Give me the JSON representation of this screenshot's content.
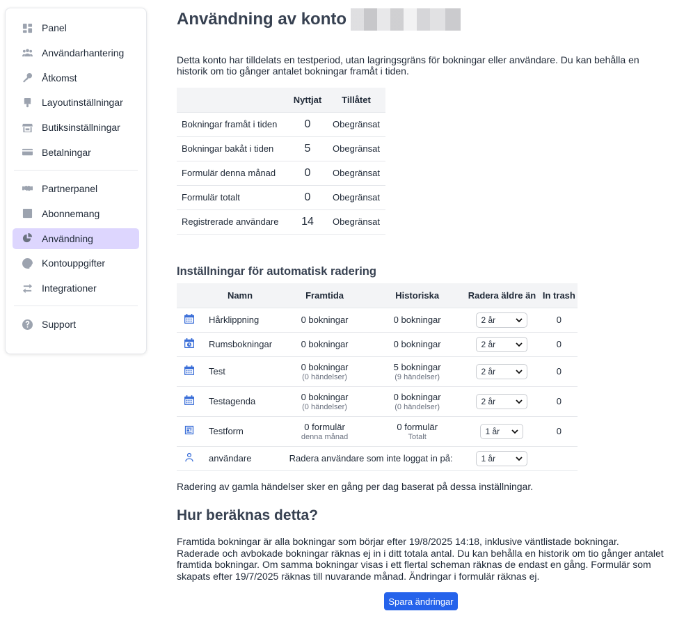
{
  "sidebar": {
    "items": [
      {
        "label": "Panel",
        "icon": "dashboard-icon"
      },
      {
        "label": "Användarhantering",
        "icon": "users-icon"
      },
      {
        "label": "Åtkomst",
        "icon": "key-icon"
      },
      {
        "label": "Layoutinställningar",
        "icon": "brush-icon"
      },
      {
        "label": "Butiksinställningar",
        "icon": "store-icon"
      },
      {
        "label": "Betalningar",
        "icon": "credit-card-icon"
      },
      {
        "label": "Partnerpanel",
        "icon": "handshake-icon"
      },
      {
        "label": "Abonnemang",
        "icon": "checkbox-icon"
      },
      {
        "label": "Användning",
        "icon": "pie-chart-icon",
        "active": true
      },
      {
        "label": "Kontouppgifter",
        "icon": "at-icon"
      },
      {
        "label": "Integrationer",
        "icon": "swap-icon"
      },
      {
        "label": "Support",
        "icon": "question-icon"
      }
    ]
  },
  "page": {
    "title": "Användning av konto",
    "intro": "Detta konto har tilldelats en testperiod, utan lagringsgräns för bokningar eller användare. Du kan behålla en historik om tio gånger antalet bokningar framåt i tiden."
  },
  "usage": {
    "headers": [
      "",
      "Nyttjat",
      "Tillåtet"
    ],
    "rows": [
      {
        "label": "Bokningar framåt i tiden",
        "used": "0",
        "allowed": "Obegränsat"
      },
      {
        "label": "Bokningar bakåt i tiden",
        "used": "5",
        "allowed": "Obegränsat"
      },
      {
        "label": "Formulär denna månad",
        "used": "0",
        "allowed": "Obegränsat"
      },
      {
        "label": "Formulär totalt",
        "used": "0",
        "allowed": "Obegränsat"
      },
      {
        "label": "Registrerade användare",
        "used": "14",
        "allowed": "Obegränsat"
      }
    ]
  },
  "autodelete": {
    "heading": "Inställningar för automatisk radering",
    "headers": [
      "",
      "Namn",
      "Framtida",
      "Historiska",
      "Radera äldre än",
      "In trash"
    ],
    "rows": [
      {
        "icon": "calendar-icon",
        "name": "Hårklippning",
        "future": "0 bokningar",
        "future_sub": "",
        "hist": "0 bokningar",
        "hist_sub": "",
        "delete": "2 år",
        "trash": "0"
      },
      {
        "icon": "calendar-clock-icon",
        "name": "Rumsbokningar",
        "future": "0 bokningar",
        "future_sub": "",
        "hist": "0 bokningar",
        "hist_sub": "",
        "delete": "2 år",
        "trash": "0"
      },
      {
        "icon": "calendar-icon",
        "name": "Test",
        "future": "0 bokningar",
        "future_sub": "(0 händelser)",
        "hist": "5 bokningar",
        "hist_sub": "(9 händelser)",
        "delete": "2 år",
        "trash": "0"
      },
      {
        "icon": "calendar-icon",
        "name": "Testagenda",
        "future": "0 bokningar",
        "future_sub": "(0 händelser)",
        "hist": "0 bokningar",
        "hist_sub": "(0 händelser)",
        "delete": "2 år",
        "trash": "0"
      },
      {
        "icon": "form-icon",
        "name": "Testform",
        "future": "0 formulär",
        "future_sub": "denna månad",
        "hist": "0 formulär",
        "hist_sub": "Totalt",
        "delete": "1 år",
        "trash": "0"
      }
    ],
    "users_row": {
      "icon": "user-icon",
      "name": "användare",
      "text": "Radera användare som inte loggat in på:",
      "delete": "1 år"
    },
    "note": "Radering av gamla händelser sker en gång per dag baserat på dessa inställningar."
  },
  "howto": {
    "heading": "Hur beräknas detta?",
    "text": "Framtida bokningar är alla bokningar som börjar efter 19/8/2025 14:18, inklusive väntlistade bokningar. Raderade och avbokade bokningar räknas ej in i ditt totala antal. Du kan behålla en historik om tio gånger antalet framtida bokningar. Om samma bokningar visas i ett flertal scheman räknas de endast en gång. Formulär som skapats efter 19/7/2025 räknas till nuvarande månad. Ändringar i formulär räknas ej."
  },
  "save_label": "Spara ändringar",
  "colors": {
    "accent": "#2563eb",
    "active_nav": "#ddd6fe",
    "icon_blue": "#3b6fd8"
  }
}
